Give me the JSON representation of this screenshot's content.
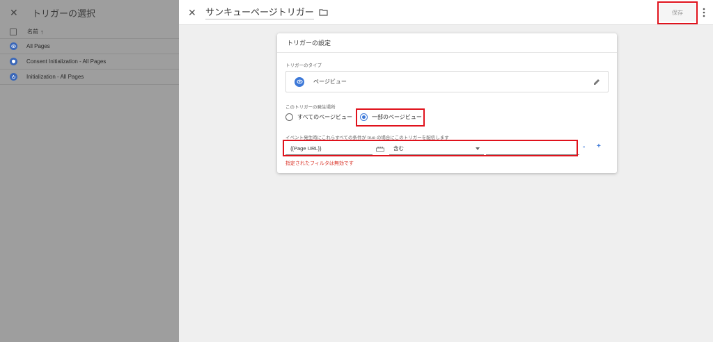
{
  "left_panel": {
    "title": "トリガーの選択",
    "column_header": "名前",
    "rows": [
      {
        "label": "All Pages",
        "icon": "eye-icon"
      },
      {
        "label": "Consent Initialization - All Pages",
        "icon": "shield-icon"
      },
      {
        "label": "Initialization - All Pages",
        "icon": "power-icon"
      }
    ]
  },
  "editor": {
    "trigger_name": "サンキューページトリガー",
    "save_label": "保存",
    "card": {
      "title": "トリガーの設定",
      "type_section_label": "トリガーのタイプ",
      "type_value": "ページビュー",
      "occurrence_label": "このトリガーの発生場所",
      "radio_all": "すべてのページビュー",
      "radio_some": "一部のページビュー",
      "selected_radio": "some",
      "condition_label": "イベント発生時にこれらすべての条件が true の場合にこのトリガーを配信します",
      "filter": {
        "variable": "{{Page URL}}",
        "operator": "含む",
        "value": ""
      },
      "minus": "-",
      "plus": "+",
      "error": "指定されたフィルタは無効です"
    }
  },
  "colors": {
    "highlight": "#e0121c",
    "accent": "#3c78d8",
    "error": "#d93025"
  }
}
